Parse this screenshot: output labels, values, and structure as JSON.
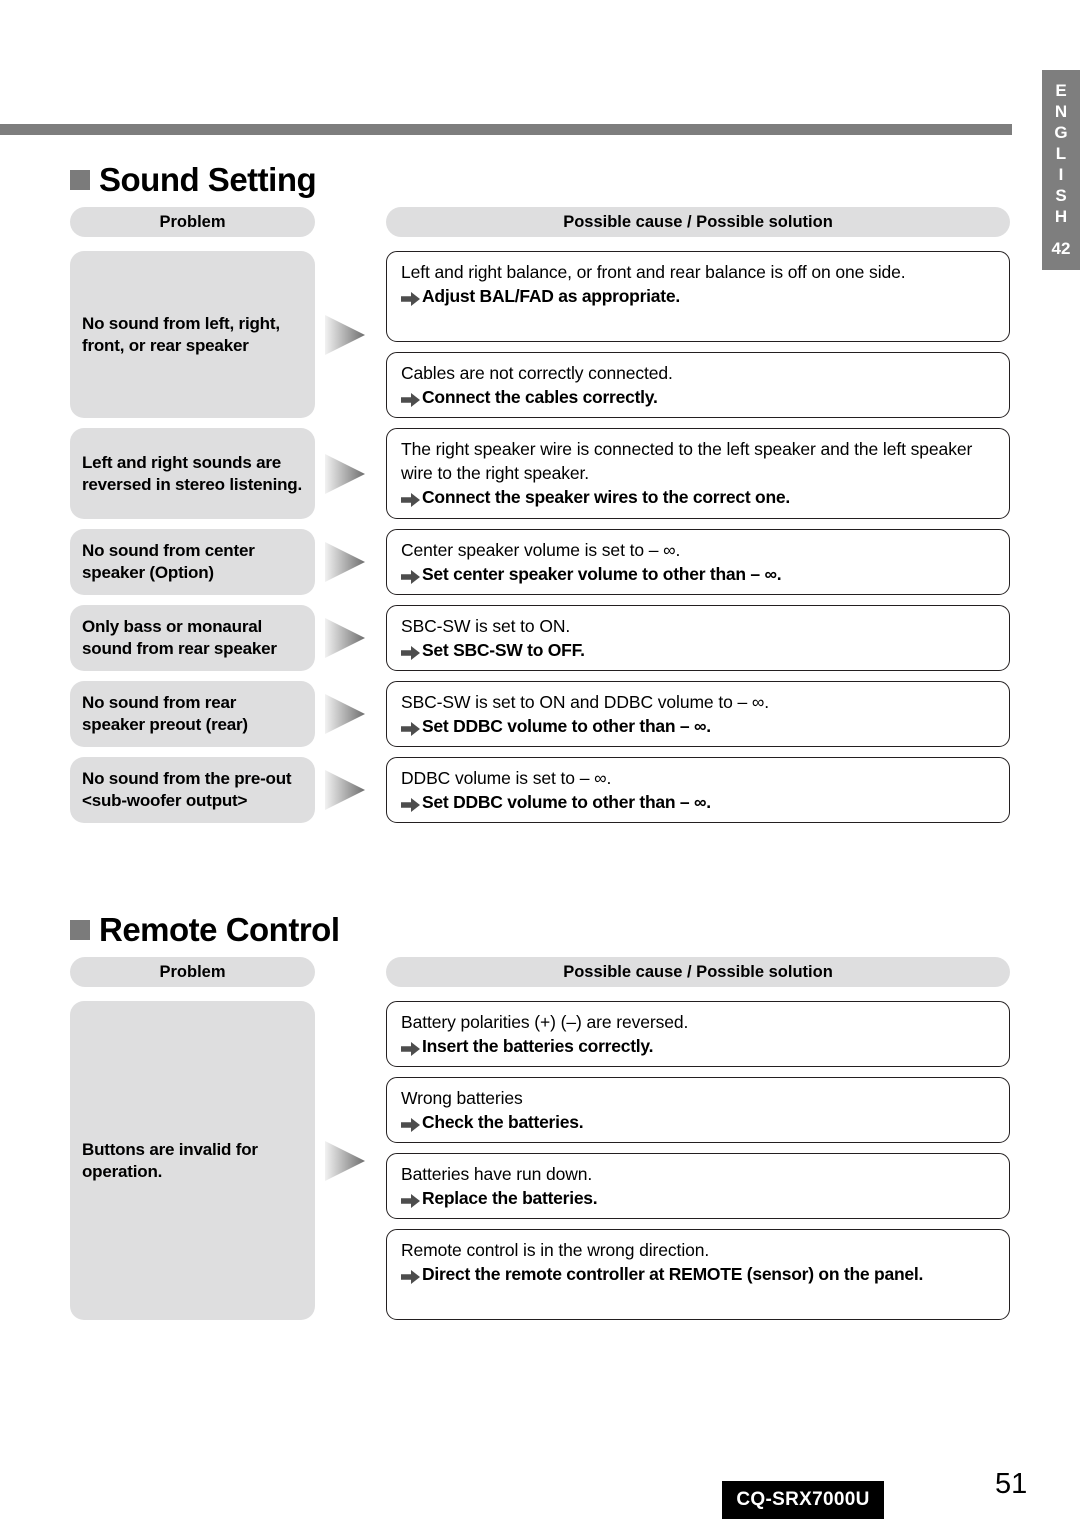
{
  "page": {
    "footer_model": "CQ-SRX7000U",
    "page_number": "51"
  },
  "language_tab": {
    "letters": [
      "E",
      "N",
      "G",
      "L",
      "I",
      "S",
      "H"
    ],
    "label": "ENGLISH",
    "number": "42"
  },
  "sections": [
    {
      "title": "Sound Setting",
      "headers": {
        "problem": "Problem",
        "cause": "Possible cause / Possible solution"
      },
      "problems": [
        {
          "label": "No sound from left, right, front, or rear speaker",
          "solutions": [
            {
              "cause": "Left and right balance, or front and rear balance is off on one side.",
              "fix": "Adjust BAL/FAD as appropriate."
            },
            {
              "cause": "Cables are not correctly connected.",
              "fix": "Connect the cables correctly."
            }
          ]
        },
        {
          "label": "Left and right sounds are reversed in stereo listening.",
          "solutions": [
            {
              "cause": "The right speaker wire is connected to the left speaker and the left speaker wire to the right speaker.",
              "fix": "Connect the speaker wires to the correct one."
            }
          ]
        },
        {
          "label": "No sound from center speaker (Option)",
          "solutions": [
            {
              "cause": "Center speaker volume is set to – ∞.",
              "fix": "Set center speaker volume to other than – ∞."
            }
          ]
        },
        {
          "label": "Only bass or monaural sound from rear speaker",
          "solutions": [
            {
              "cause": "SBC-SW is set to ON.",
              "fix": "Set SBC-SW to OFF."
            }
          ]
        },
        {
          "label": "No sound from rear speaker preout (rear)",
          "solutions": [
            {
              "cause": "SBC-SW is set to ON and DDBC volume to – ∞.",
              "fix": "Set DDBC volume to other than – ∞."
            }
          ]
        },
        {
          "label": "No sound from the pre-out <sub-woofer output>",
          "solutions": [
            {
              "cause": "DDBC volume is set to – ∞.",
              "fix": "Set DDBC volume to other than – ∞."
            }
          ]
        }
      ]
    },
    {
      "title": "Remote Control",
      "headers": {
        "problem": "Problem",
        "cause": "Possible cause / Possible solution"
      },
      "problems": [
        {
          "label": "Buttons are invalid for operation.",
          "solutions": [
            {
              "cause": "Battery polarities (+) (–) are reversed.",
              "fix": "Insert the batteries correctly."
            },
            {
              "cause": "Wrong batteries",
              "fix": "Check the batteries."
            },
            {
              "cause": "Batteries have run down.",
              "fix": "Replace the batteries."
            },
            {
              "cause": "Remote control is in the wrong direction.",
              "fix": "Direct the remote controller at REMOTE (sensor) on the panel."
            }
          ]
        }
      ]
    }
  ],
  "colors": {
    "pill_gray": "#dededf",
    "tab_gray": "#7e7e7e",
    "rule_gray": "#7e7e7e",
    "text_black": "#000000"
  },
  "icons": {
    "heading_bullet": "filled-square",
    "row_arrow": "gradient-right-triangle",
    "inline_arrow": "right-arrow"
  }
}
